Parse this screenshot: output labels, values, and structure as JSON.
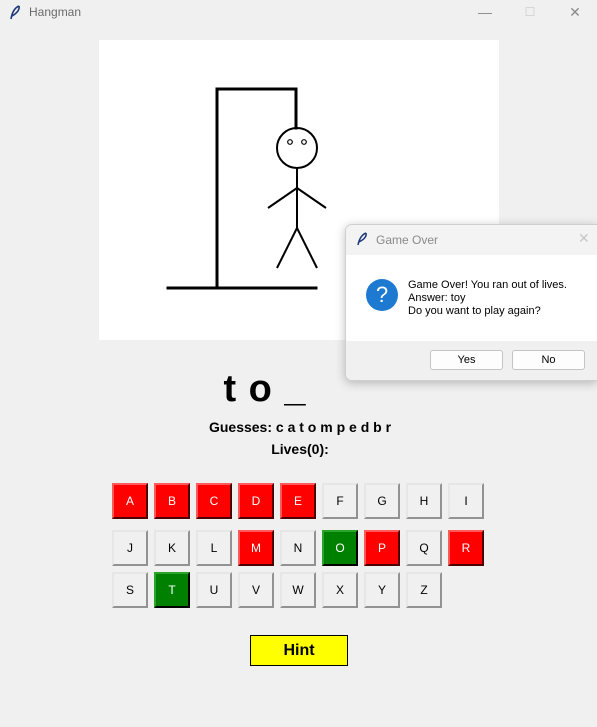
{
  "window": {
    "title": "Hangman",
    "minimize": "—",
    "maximize": "☐",
    "close": "✕"
  },
  "game": {
    "word_display": "t o _",
    "guesses_text": "Guesses: c a t o m p e d b r",
    "lives_text": "Lives(0):"
  },
  "keyboard": {
    "rows": [
      [
        {
          "label": "A",
          "state": "wrong"
        },
        {
          "label": "B",
          "state": "wrong"
        },
        {
          "label": "C",
          "state": "wrong"
        },
        {
          "label": "D",
          "state": "wrong"
        },
        {
          "label": "E",
          "state": "wrong"
        },
        {
          "label": "F",
          "state": "unused"
        },
        {
          "label": "G",
          "state": "unused"
        },
        {
          "label": "H",
          "state": "unused"
        },
        {
          "label": "I",
          "state": "unused"
        }
      ],
      [
        {
          "label": "J",
          "state": "unused"
        },
        {
          "label": "K",
          "state": "unused"
        },
        {
          "label": "L",
          "state": "unused"
        },
        {
          "label": "M",
          "state": "wrong"
        },
        {
          "label": "N",
          "state": "unused"
        },
        {
          "label": "O",
          "state": "correct"
        },
        {
          "label": "P",
          "state": "wrong"
        },
        {
          "label": "Q",
          "state": "unused"
        },
        {
          "label": "R",
          "state": "wrong"
        }
      ],
      [
        {
          "label": "S",
          "state": "unused"
        },
        {
          "label": "T",
          "state": "correct"
        },
        {
          "label": "U",
          "state": "unused"
        },
        {
          "label": "V",
          "state": "unused"
        },
        {
          "label": "W",
          "state": "unused"
        },
        {
          "label": "X",
          "state": "unused"
        },
        {
          "label": "Y",
          "state": "unused"
        },
        {
          "label": "Z",
          "state": "unused"
        }
      ]
    ],
    "colors": {
      "wrong": "#ff0000",
      "correct": "#008000",
      "unused": "#f0f0f0"
    }
  },
  "hint_label": "Hint",
  "hint_color": "#ffff00",
  "dialog": {
    "title": "Game Over",
    "close": "✕",
    "icon": "question-icon",
    "message_line1": "Game Over! You ran out of lives.",
    "message_line2": "Answer: toy",
    "message_line3": "Do you want to play again?",
    "yes_label": "Yes",
    "no_label": "No"
  }
}
